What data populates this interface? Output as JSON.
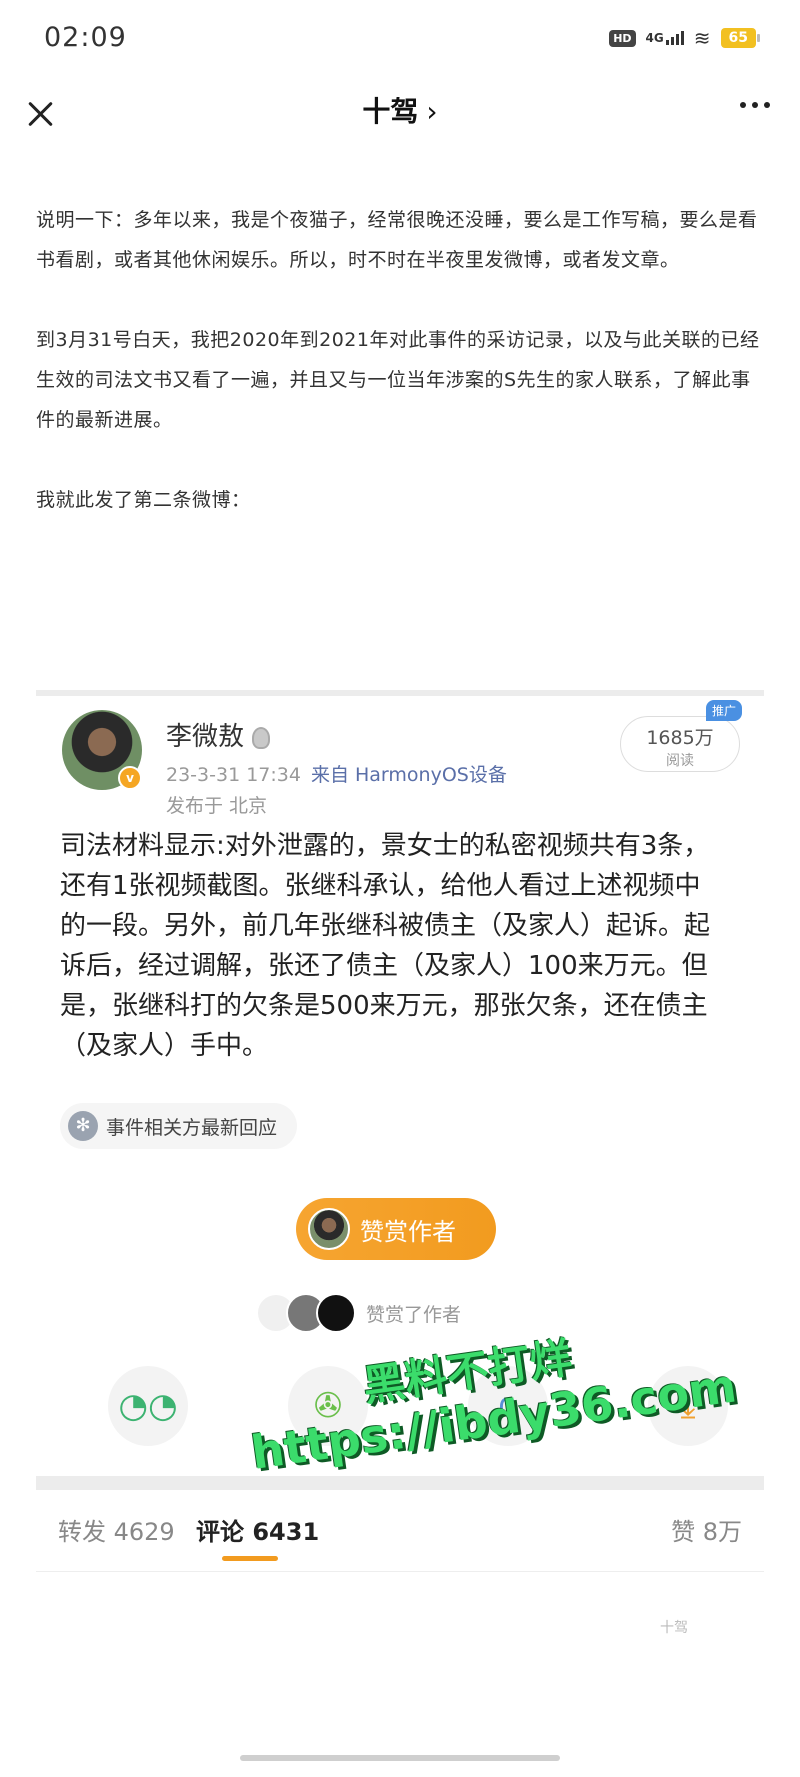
{
  "status_bar": {
    "time": "02:09",
    "hd": "HD",
    "network": "4G",
    "battery": "65"
  },
  "nav": {
    "title": "十驾",
    "chevron": "›"
  },
  "article": {
    "paragraphs": [
      "说明一下：多年以来，我是个夜猫子，经常很晚还没睡，要么是工作写稿，要么是看书看剧，或者其他休闲娱乐。所以，时不时在半夜里发微博，或者发文章。",
      "到3月31号白天，我把2020年到2021年对此事件的采访记录，以及与此关联的已经生效的司法文书又看了一遍，并且又与一位当年涉案的S先生的家人联系，了解此事件的最新进展。",
      "我就此发了第二条微博："
    ]
  },
  "weibo": {
    "author": "李微敖",
    "timestamp": "23-3-31 17:34",
    "source": "来自 HarmonyOS设备",
    "location": "发布于 北京",
    "read_count": "1685万",
    "read_label": "阅读",
    "promo_tag": "推广",
    "body": "司法材料显示:对外泄露的，景女士的私密视频共有3条，还有1张视频截图。张继科承认，给他人看过上述视频中的一段。另外，前几年张继科被债主（及家人）起诉。起诉后，经过调解，张还了债主（及家人）100来万元。但是，张继科打的欠条是500来万元，那张欠条，还在债主（及家人）手中。",
    "related_chip": "事件相关方最新回应",
    "reward_button": "赞赏作者",
    "rewarders_text": "赞赏了作者",
    "tabs": {
      "repost": "转发 4629",
      "comment": "评论 6431",
      "like": "赞 8万"
    }
  },
  "watermark": {
    "line1": "黑料不打烊",
    "line2": "https://ibdy36.com",
    "corner": "十驾"
  },
  "icons": {
    "close": "close-icon",
    "more": "more-icon",
    "wechat": "wechat-icon",
    "moments": "moments-icon",
    "share": "share-icon",
    "download": "download-icon"
  },
  "colors": {
    "accent": "#f29b1f",
    "link": "#5a6fa8",
    "watermark": "#3bdc6b"
  }
}
